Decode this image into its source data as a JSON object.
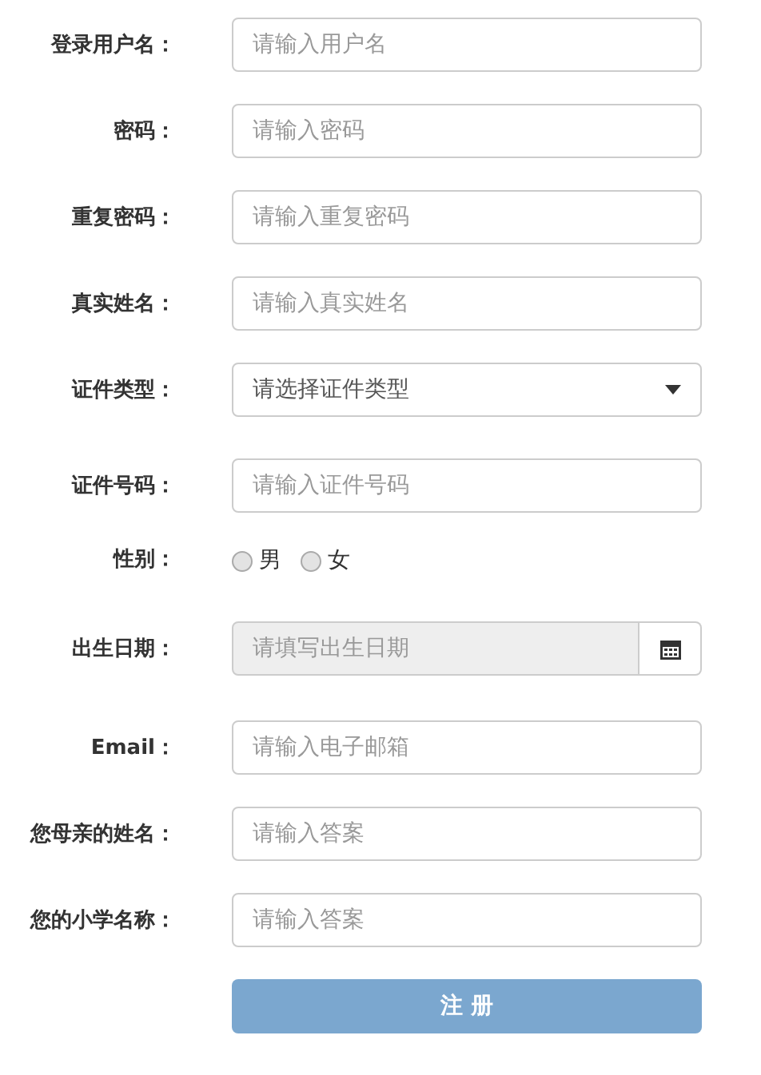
{
  "fields": [
    {
      "kind": "text",
      "label": "登录用户名：",
      "placeholder": "请输入用户名"
    },
    {
      "kind": "text",
      "label": "密码：",
      "placeholder": "请输入密码"
    },
    {
      "kind": "text",
      "label": "重复密码：",
      "placeholder": "请输入重复密码"
    },
    {
      "kind": "text",
      "label": "真实姓名：",
      "placeholder": "请输入真实姓名"
    },
    {
      "kind": "select",
      "label": "证件类型：",
      "value": "请选择证件类型"
    },
    {
      "kind": "text",
      "label": "证件号码：",
      "placeholder": "请输入证件号码"
    },
    {
      "kind": "radio",
      "label": "性别：",
      "options": [
        {
          "label": "男",
          "selected": false
        },
        {
          "label": "女",
          "selected": false
        }
      ]
    },
    {
      "kind": "date",
      "label": "出生日期：",
      "placeholder": "请填写出生日期"
    },
    {
      "kind": "text",
      "label": "Email：",
      "placeholder": "请输入电子邮箱"
    },
    {
      "kind": "text",
      "label": "您母亲的姓名：",
      "placeholder": "请输入答案"
    },
    {
      "kind": "text",
      "label": "您的小学名称：",
      "placeholder": "请输入答案"
    }
  ],
  "submit": {
    "label": "注 册",
    "disabled": true
  }
}
